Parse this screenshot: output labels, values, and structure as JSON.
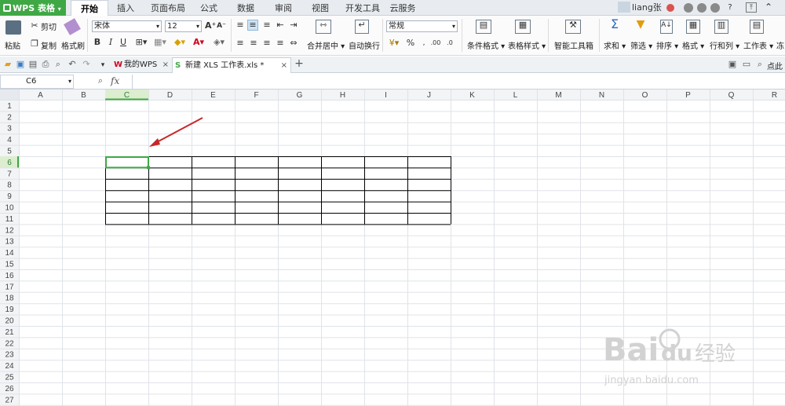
{
  "app": {
    "logo_label": "WPS 表格"
  },
  "menu_tabs": [
    "开始",
    "插入",
    "页面布局",
    "公式",
    "数据",
    "审阅",
    "视图",
    "开发工具",
    "云服务"
  ],
  "user": {
    "name": "liang张"
  },
  "ribbon": {
    "paste": "粘贴",
    "cut": "剪切",
    "copy": "复制",
    "format_painter": "格式刷",
    "font_name": "宋体",
    "font_size": "12",
    "merge_center": "合并居中",
    "wrap_text": "自动换行",
    "number_format": "常规",
    "percent": "%",
    "cond_format": "条件格式",
    "table_style": "表格样式",
    "smart_toolbox": "智能工具箱",
    "sum": "求和",
    "filter": "筛选",
    "sort": "排序",
    "format": "格式",
    "row_col": "行和列",
    "worksheet": "工作表",
    "more": "冻"
  },
  "doc_tabs": {
    "mywps": "我的WPS",
    "active": "新建 XLS 工作表.xls *"
  },
  "right_tools": {
    "search": "点此"
  },
  "formula": {
    "cell_ref": "C6",
    "fx": "fx"
  },
  "sheet": {
    "columns": [
      "A",
      "B",
      "C",
      "D",
      "E",
      "F",
      "G",
      "H",
      "I",
      "J",
      "K",
      "L",
      "M",
      "N",
      "O",
      "P",
      "Q",
      "R"
    ],
    "rows": [
      "1",
      "2",
      "3",
      "4",
      "5",
      "6",
      "7",
      "8",
      "9",
      "10",
      "11",
      "12",
      "13",
      "14",
      "15",
      "16",
      "17",
      "18",
      "19",
      "20",
      "21",
      "22",
      "23",
      "24",
      "25",
      "26",
      "27"
    ],
    "active_col": "C",
    "active_row": "6"
  },
  "watermark": {
    "brand": "Bai",
    "brand2": "du",
    "cn": "经验",
    "url": "jingyan.baidu.com"
  }
}
